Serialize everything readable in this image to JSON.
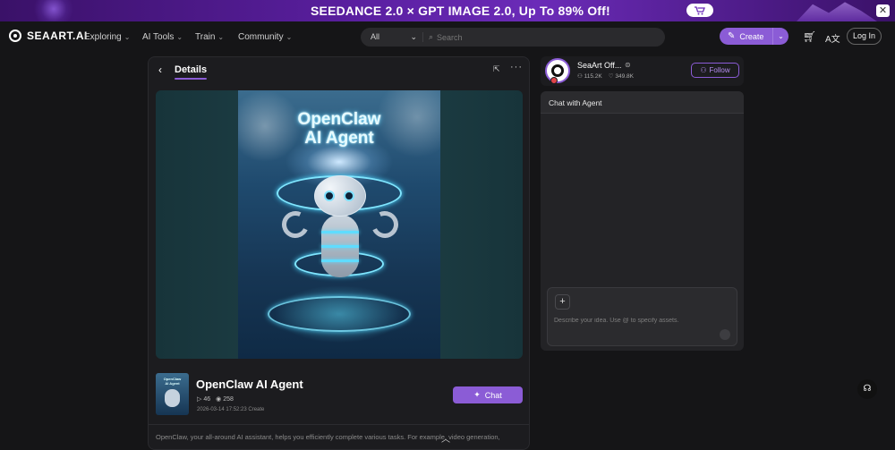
{
  "banner": {
    "text": "SEEDANCE 2.0 × GPT IMAGE 2.0, Up To 89% Off!",
    "cart_icon": "cart-icon",
    "close_icon": "close-icon"
  },
  "nav": {
    "logo": "SEAART.AI",
    "items": [
      {
        "label": "Exploring"
      },
      {
        "label": "AI Tools"
      },
      {
        "label": "Train"
      },
      {
        "label": "Community"
      }
    ],
    "search": {
      "category": "All",
      "placeholder": "Search"
    },
    "create_label": "Create",
    "login_label": "Log In"
  },
  "details": {
    "header_title": "Details",
    "poster_title": "OpenClaw\nAI Agent",
    "title": "OpenClaw AI Agent",
    "plays": "46",
    "views": "258",
    "date": "2026-03-14 17:52:23 Create",
    "chat_label": "Chat",
    "description": "OpenClaw, your all-around AI assistant, helps you efficiently complete various tasks. For example, video generation,"
  },
  "author": {
    "name": "SeaArt Off...",
    "followers": "115.2K",
    "likes": "349.8K",
    "follow_label": "Follow"
  },
  "chat": {
    "title": "Chat with Agent",
    "input_placeholder": "Describe your idea. Use @ to specify assets."
  },
  "colors": {
    "accent": "#8b5cd6",
    "background": "#151517",
    "panel": "#1c1c1f"
  }
}
